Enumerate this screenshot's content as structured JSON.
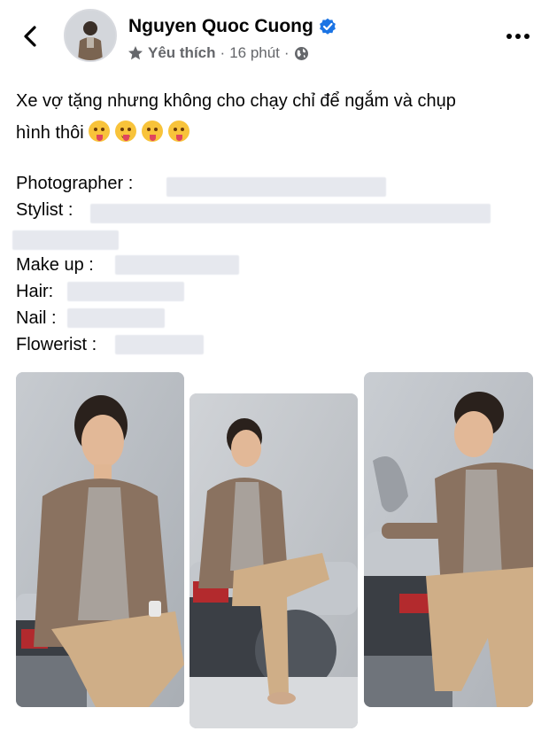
{
  "post": {
    "author": "Nguyen Quoc Cuong",
    "privacy_label": "Yêu thích",
    "separator": "·",
    "time": "16 phút",
    "caption_line1": "Xe vợ tặng nhưng không cho chạy chỉ để ngắm và chụp",
    "caption_line2": "hình thôi",
    "credits": {
      "photographer": "Photographer :",
      "stylist": "Stylist :",
      "makeup": "Make up :",
      "hair": "Hair:",
      "nail": "Nail :",
      "flowerist": "Flowerist :"
    },
    "photos": [
      {
        "description_icon": "photo-1"
      },
      {
        "description_icon": "photo-2"
      },
      {
        "description_icon": "photo-3"
      }
    ]
  },
  "icons": {
    "back": "chevron-left-icon",
    "verified": "verified-badge-icon",
    "favorite": "star-icon",
    "privacy": "globe-icon",
    "more": "more-horizontal-icon"
  },
  "colors": {
    "verified": "#1b74e4",
    "meta": "#65676b",
    "text": "#050505"
  }
}
